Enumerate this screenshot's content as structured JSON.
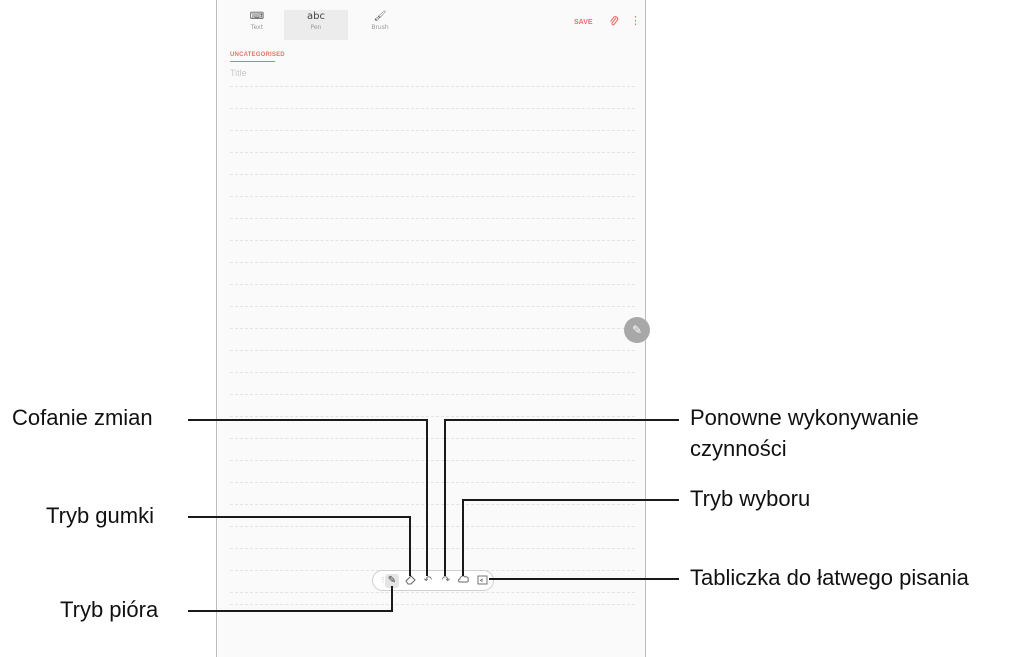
{
  "app": {
    "tabs": [
      {
        "label": "Text",
        "icon": "keyboard-icon"
      },
      {
        "label": "Pen",
        "icon": "handwriting-icon",
        "glyph": "abc"
      },
      {
        "label": "Brush",
        "icon": "brush-icon"
      }
    ],
    "save_label": "SAVE",
    "category_label": "UNCATEGORISED",
    "title_placeholder": "Title"
  },
  "pen_toolbar": {
    "tools": [
      "handle-icon",
      "pen-icon",
      "eraser-icon",
      "undo-icon",
      "redo-icon",
      "selection-icon",
      "easy-writing-pad-icon"
    ]
  },
  "callouts": {
    "undo": "Cofanie zmian",
    "eraser": "Tryb gumki",
    "pen": "Tryb pióra",
    "redo_line1": "Ponowne wykonywanie",
    "redo_line2": "czynności",
    "selection": "Tryb wyboru",
    "writing_pad": "Tabliczka do łatwego pisania"
  },
  "colors": {
    "accent": "#e8726a",
    "line": "#1a1a1a"
  }
}
